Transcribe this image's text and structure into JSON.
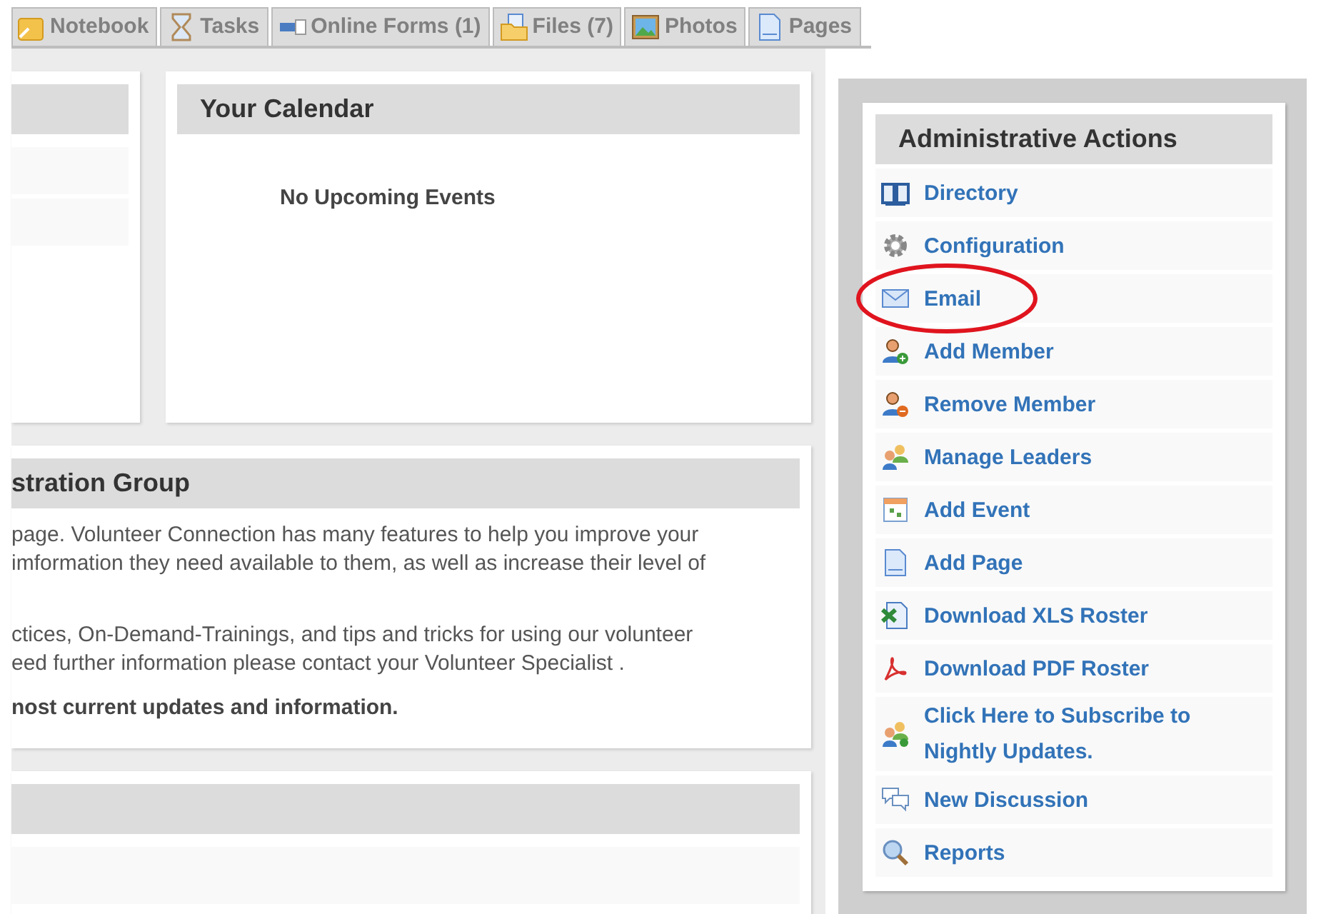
{
  "tabs": [
    {
      "label": "Notebook"
    },
    {
      "label": "Tasks"
    },
    {
      "label": "Online Forms (1)"
    },
    {
      "label": "Files (7)"
    },
    {
      "label": "Photos"
    },
    {
      "label": "Pages"
    }
  ],
  "calendar": {
    "title": "Your Calendar",
    "empty_text": "No Upcoming Events"
  },
  "group_panel": {
    "title": "stration Group",
    "paragraphs": [
      [
        "page. Volunteer Connection has many features to help you improve your",
        "imformation they need available to them, as well as increase their level of"
      ],
      [
        "ctices, On-Demand-Trainings, and tips and tricks for using our volunteer",
        "eed further information please contact your Volunteer Specialist ."
      ],
      [
        "nost current updates and information."
      ]
    ]
  },
  "admin": {
    "title": "Administrative Actions",
    "actions": [
      {
        "label": "Directory",
        "circled": false
      },
      {
        "label": "Configuration",
        "circled": false
      },
      {
        "label": "Email",
        "circled": true
      },
      {
        "label": "Add Member",
        "circled": false
      },
      {
        "label": "Remove Member",
        "circled": false
      },
      {
        "label": "Manage Leaders",
        "circled": false
      },
      {
        "label": "Add Event",
        "circled": false
      },
      {
        "label": "Add Page",
        "circled": false
      },
      {
        "label": "Download XLS Roster",
        "circled": false
      },
      {
        "label": "Download PDF Roster",
        "circled": false
      },
      {
        "label": "Click Here to Subscribe to Nightly Updates.",
        "circled": false
      },
      {
        "label": "New Discussion",
        "circled": false
      },
      {
        "label": "Reports",
        "circled": false
      }
    ]
  }
}
